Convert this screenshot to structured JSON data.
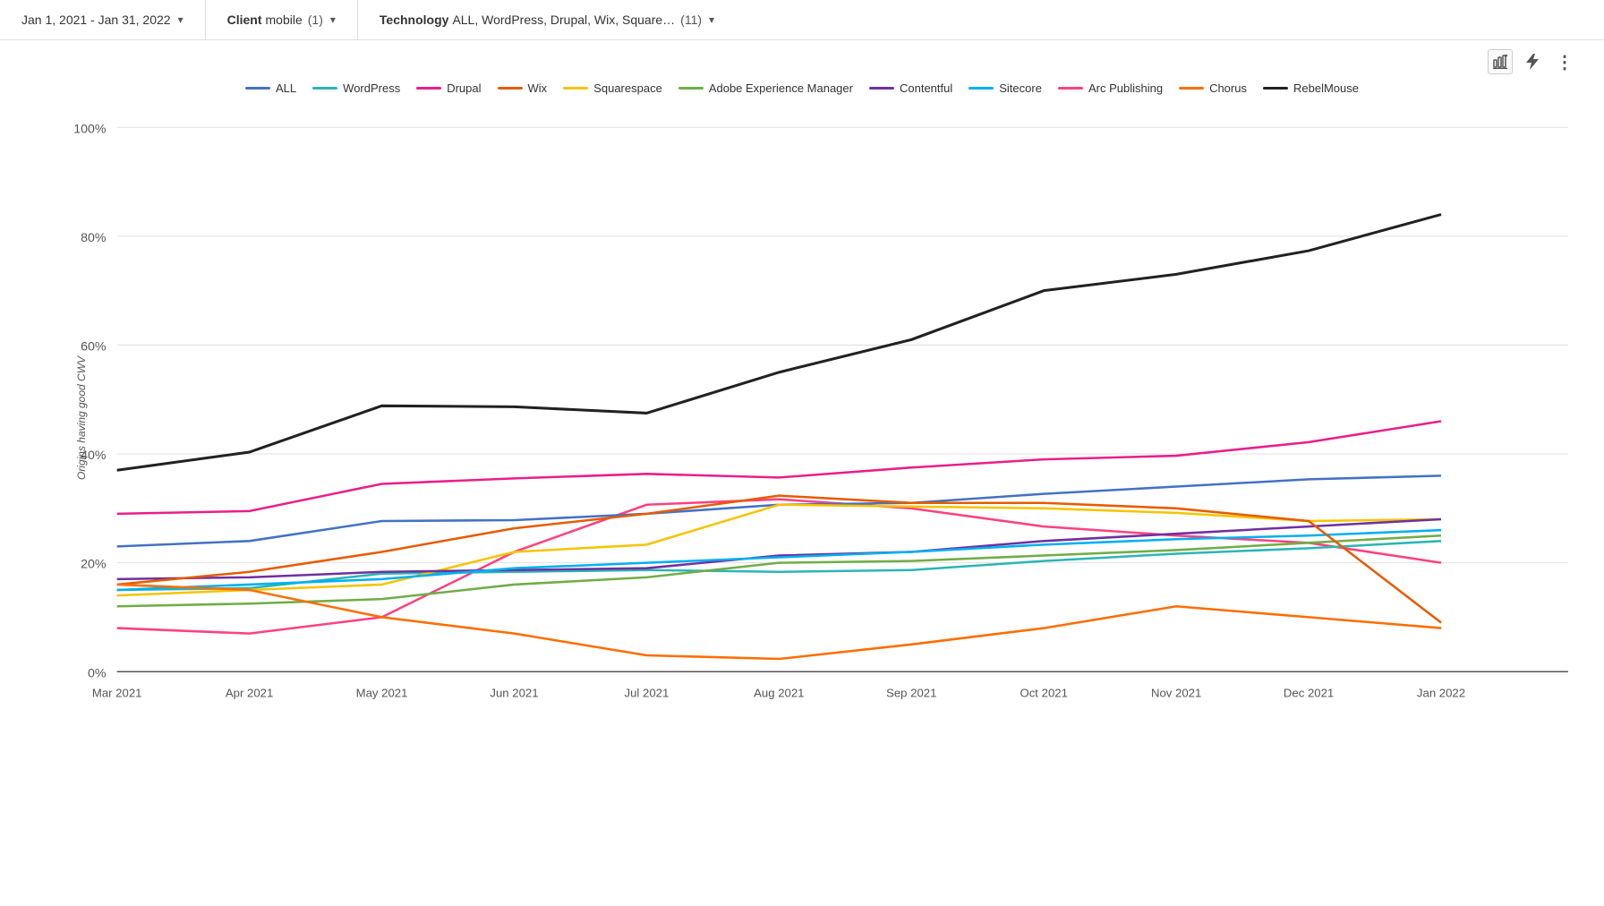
{
  "topbar": {
    "date_range": "Jan 1, 2021 - Jan 31, 2022",
    "client_label": "Client",
    "client_value": "mobile",
    "client_count": "(1)",
    "tech_label": "Technology",
    "tech_value": "ALL, WordPress, Drupal, Wix, Square…",
    "tech_count": "(11)"
  },
  "legend": [
    {
      "name": "ALL",
      "color": "#4472C4",
      "dash": false
    },
    {
      "name": "WordPress",
      "color": "#2BB5B5",
      "dash": false
    },
    {
      "name": "Drupal",
      "color": "#E91E8C",
      "dash": false
    },
    {
      "name": "Wix",
      "color": "#E65C00",
      "dash": false
    },
    {
      "name": "Squarespace",
      "color": "#F5C400",
      "dash": false
    },
    {
      "name": "Adobe Experience Manager",
      "color": "#70AD47",
      "dash": false
    },
    {
      "name": "Contentful",
      "color": "#7030A0",
      "dash": false
    },
    {
      "name": "Sitecore",
      "color": "#00B0F0",
      "dash": false
    },
    {
      "name": "Arc Publishing",
      "color": "#FF4081",
      "dash": false
    },
    {
      "name": "Chorus",
      "color": "#FF6D00",
      "dash": false
    },
    {
      "name": "RebelMouse",
      "color": "#212121",
      "dash": false
    }
  ],
  "yaxis": {
    "labels": [
      "100%",
      "80%",
      "60%",
      "40%",
      "20%",
      "0%"
    ]
  },
  "xaxis": {
    "labels": [
      "Mar 2021",
      "Apr 2021",
      "May 2021",
      "Jun 2021",
      "Jul 2021",
      "Aug 2021",
      "Sep 2021",
      "Oct 2021",
      "Nov 2021",
      "Dec 2021",
      "Jan 2022"
    ]
  },
  "yaxis_title": "Origins having good CWV",
  "toolbar": {
    "chart_icon": "▦",
    "bolt_icon": "⚡",
    "more_icon": "⋮"
  }
}
